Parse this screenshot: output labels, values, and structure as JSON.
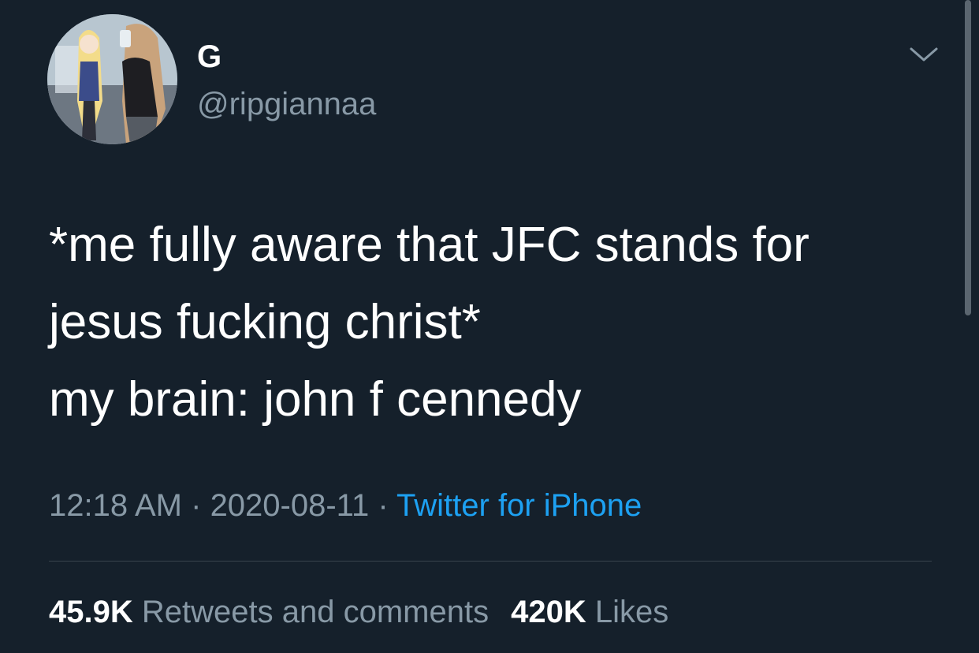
{
  "user": {
    "display_name": "G",
    "handle": "@ripgiannaa"
  },
  "icons": {
    "avatar": "avatar-image",
    "menu": "chevron-down-icon"
  },
  "tweet": {
    "lines": [
      "*me fully aware that JFC stands for",
      "jesus fucking christ*",
      "my brain: john f cennedy"
    ]
  },
  "meta": {
    "time": "12:18 AM",
    "separator_1": " · ",
    "date": "2020-08-11",
    "separator_2": " · ",
    "source": "Twitter for iPhone"
  },
  "stats": {
    "retweets_count": "45.9K",
    "retweets_label": "Retweets and comments",
    "likes_count": "420K",
    "likes_label": "Likes"
  },
  "colors": {
    "background": "#15202b",
    "primary_text": "#ffffff",
    "secondary_text": "#8899a6",
    "accent": "#1da1f2",
    "divider": "#38444d"
  }
}
